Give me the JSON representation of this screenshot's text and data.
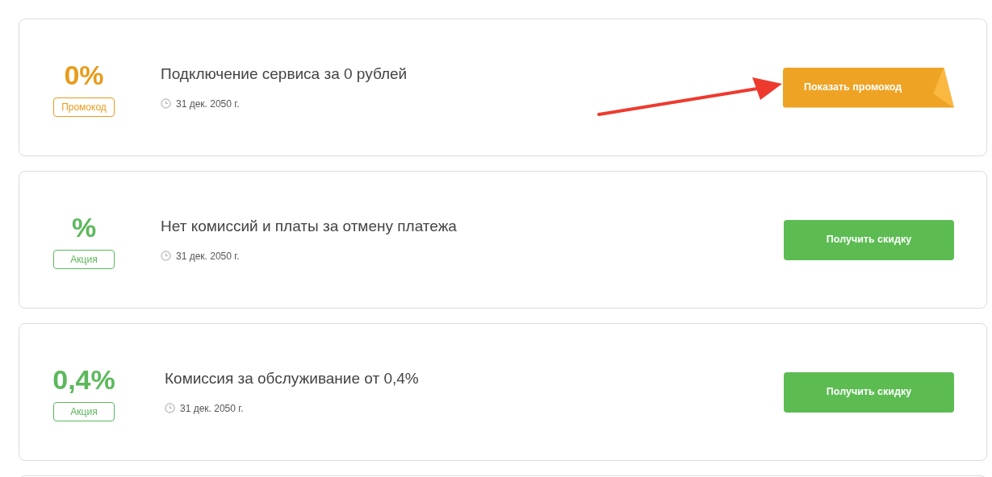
{
  "offers": [
    {
      "kind": "promocode",
      "value": "0%",
      "badge": "Промокод",
      "title": "Подключение сервиса за 0 рублей",
      "date": "31 дек. 2050 г.",
      "button": "Показать промокод"
    },
    {
      "kind": "deal",
      "value": "%",
      "badge": "Акция",
      "title": "Нет комиссий и платы за отмену платежа",
      "date": "31 дек. 2050 г.",
      "button": "Получить скидку"
    },
    {
      "kind": "deal",
      "value": "0,4%",
      "badge": "Акция",
      "title": "Комиссия за обслуживание от 0,4%",
      "date": "31 дек. 2050 г.",
      "button": "Получить скидку"
    }
  ]
}
